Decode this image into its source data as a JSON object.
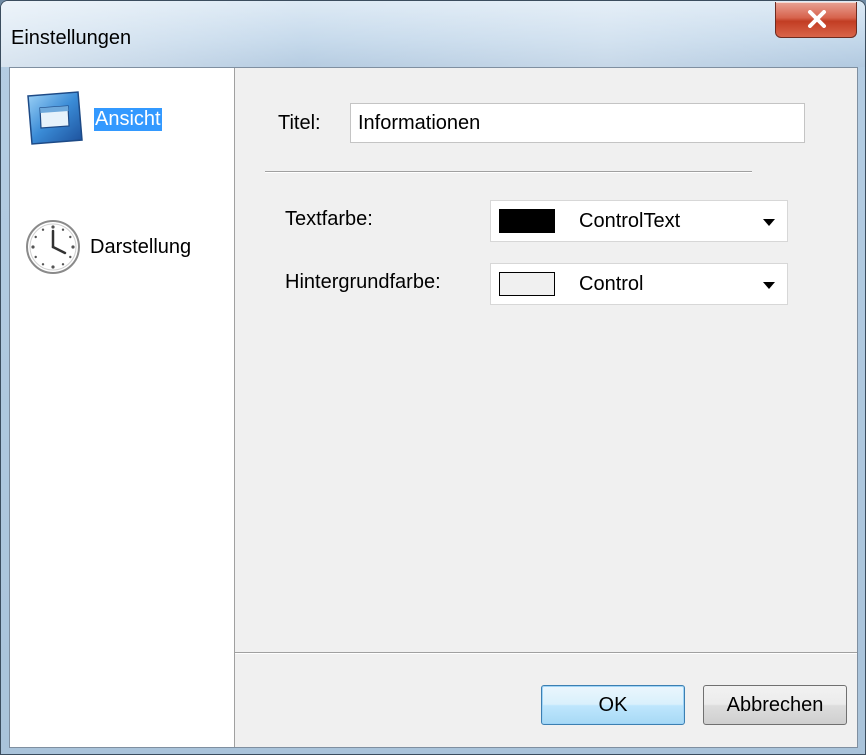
{
  "window": {
    "title": "Einstellungen"
  },
  "sidebar": {
    "items": [
      {
        "label": "Ansicht",
        "icon": "display-window-icon",
        "selected": true
      },
      {
        "label": "Darstellung",
        "icon": "clock-icon",
        "selected": false
      }
    ]
  },
  "form": {
    "title_label": "Titel:",
    "title_value": "Informationen",
    "textcolor_label": "Textfarbe:",
    "textcolor_value": "ControlText",
    "textcolor_swatch": "#000000",
    "bgcolor_label": "Hintergrundfarbe:",
    "bgcolor_value": "Control",
    "bgcolor_swatch": "#f0f0f0"
  },
  "buttons": {
    "ok": "OK",
    "cancel": "Abbrechen"
  },
  "colors": {
    "selection": "#3399ff",
    "close_button": "#c9472f"
  }
}
